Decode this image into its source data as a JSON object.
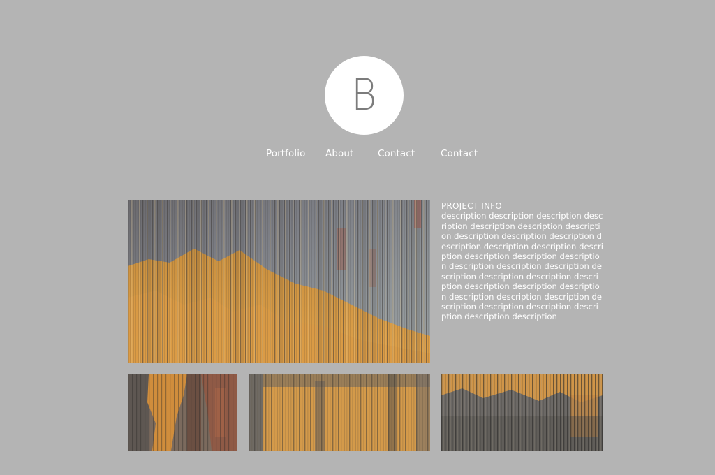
{
  "logo": {
    "letter": "B"
  },
  "nav": {
    "items": [
      {
        "label": "Portfolio",
        "active": true
      },
      {
        "label": "About",
        "active": false
      },
      {
        "label": "Contact",
        "active": false
      },
      {
        "label": "Contact",
        "active": false
      }
    ]
  },
  "project": {
    "heading": "PROJECT INFO",
    "description": "description description description description description description description description description description description description description description description description description description description description description description description description description description description description description description description description description description description description"
  },
  "images": {
    "main": "weathered-wood-texture",
    "thumbs": [
      "weathered-wood-texture",
      "weathered-wood-texture",
      "weathered-wood-texture"
    ]
  },
  "colors": {
    "background": "#b4b4b4",
    "text": "#ffffff",
    "logo_letter": "#7c7c7c"
  }
}
